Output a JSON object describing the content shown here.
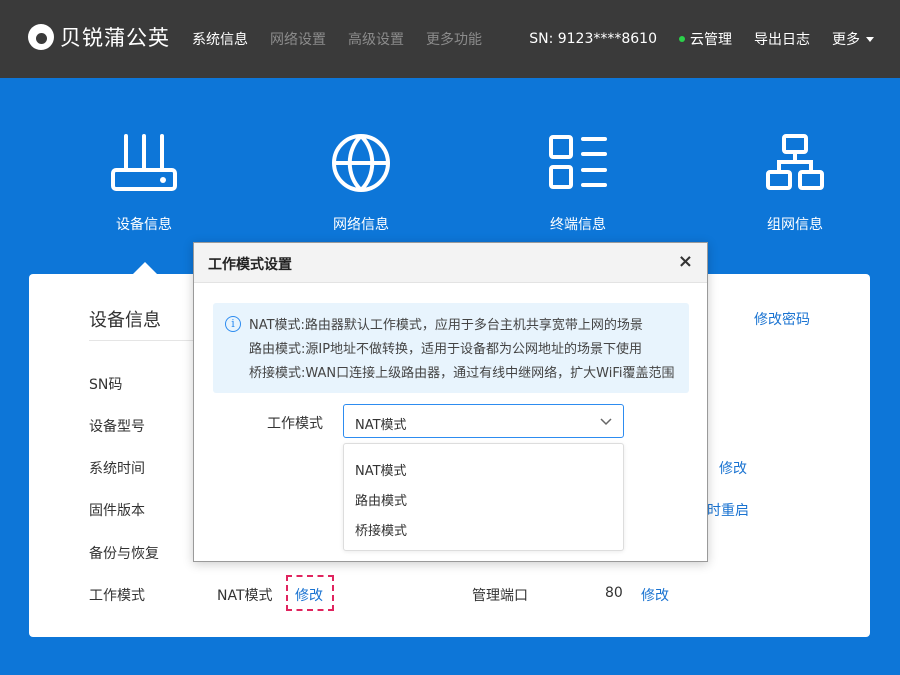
{
  "brand": {
    "name": "贝锐蒲公英"
  },
  "nav": [
    "系统信息",
    "网络设置",
    "高级设置",
    "更多功能"
  ],
  "header_right": {
    "sn": "SN:  9123****8610",
    "cloud": "云管理",
    "export_log": "导出日志",
    "more": "更多"
  },
  "sections": [
    "设备信息",
    "网络信息",
    "终端信息",
    "组网信息"
  ],
  "card": {
    "title": "设备信息",
    "change_password": "修改密码",
    "rows": [
      "SN码",
      "设备型号",
      "系统时间",
      "固件版本",
      "备份与恢复",
      "工作模式"
    ],
    "work_mode_value": "NAT模式",
    "modify": "修改",
    "mgmt_port_label": "管理端口",
    "mgmt_port_value": "80",
    "partial_reboot": "时重启",
    "time_modify": "修改"
  },
  "modal": {
    "title": "工作模式设置",
    "close": "×",
    "info": [
      "NAT模式:路由器默认工作模式，应用于多台主机共享宽带上网的场景",
      "路由模式:源IP地址不做转换，适用于设备都为公网地址的场景下使用",
      "桥接模式:WAN口连接上级路由器，通过有线中继网络，扩大WiFi覆盖范围"
    ],
    "field_label": "工作模式",
    "selected": "NAT模式",
    "options": [
      "NAT模式",
      "路由模式",
      "桥接模式"
    ]
  }
}
